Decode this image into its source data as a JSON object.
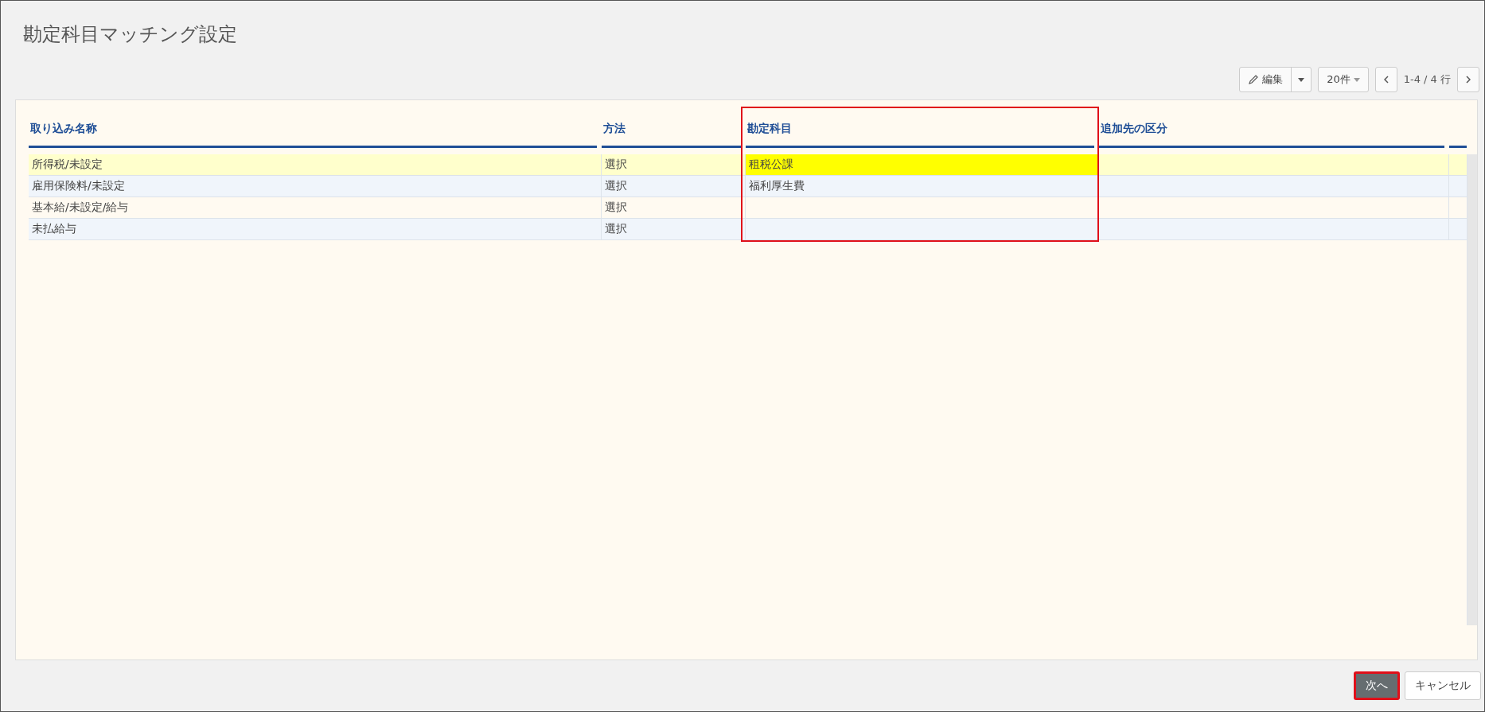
{
  "title": "勘定科目マッチング設定",
  "toolbar": {
    "edit": "編集",
    "page_size": "20件",
    "range": "1-4 / 4 行"
  },
  "table": {
    "columns": [
      {
        "label": "取り込み名称",
        "annotated": false
      },
      {
        "label": "方法",
        "annotated": false
      },
      {
        "label": "勘定科目",
        "annotated": true
      },
      {
        "label": "追加先の区分",
        "annotated": false
      }
    ],
    "rows": [
      {
        "selected": true,
        "cells": [
          {
            "text": "所得税/未設定",
            "highlighted": false
          },
          {
            "text": "選択",
            "highlighted": false
          },
          {
            "text": "租税公課",
            "highlighted": true
          },
          {
            "text": "",
            "highlighted": false
          }
        ]
      },
      {
        "selected": false,
        "cells": [
          {
            "text": "雇用保険料/未設定",
            "highlighted": false
          },
          {
            "text": "選択",
            "highlighted": false
          },
          {
            "text": "福利厚生費",
            "highlighted": false
          },
          {
            "text": "",
            "highlighted": false
          }
        ]
      },
      {
        "selected": false,
        "cells": [
          {
            "text": "基本給/未設定/給与",
            "highlighted": false
          },
          {
            "text": "選択",
            "highlighted": false
          },
          {
            "text": "",
            "highlighted": false
          },
          {
            "text": "",
            "highlighted": false
          }
        ]
      },
      {
        "selected": false,
        "cells": [
          {
            "text": "未払給与",
            "highlighted": false
          },
          {
            "text": "選択",
            "highlighted": false
          },
          {
            "text": "",
            "highlighted": false
          },
          {
            "text": "",
            "highlighted": false
          }
        ]
      }
    ]
  },
  "footer": {
    "buttons": [
      {
        "label": "次へ",
        "kind": "primary",
        "annotated": true
      },
      {
        "label": "キャンセル",
        "kind": "secondary",
        "annotated": false
      }
    ]
  }
}
